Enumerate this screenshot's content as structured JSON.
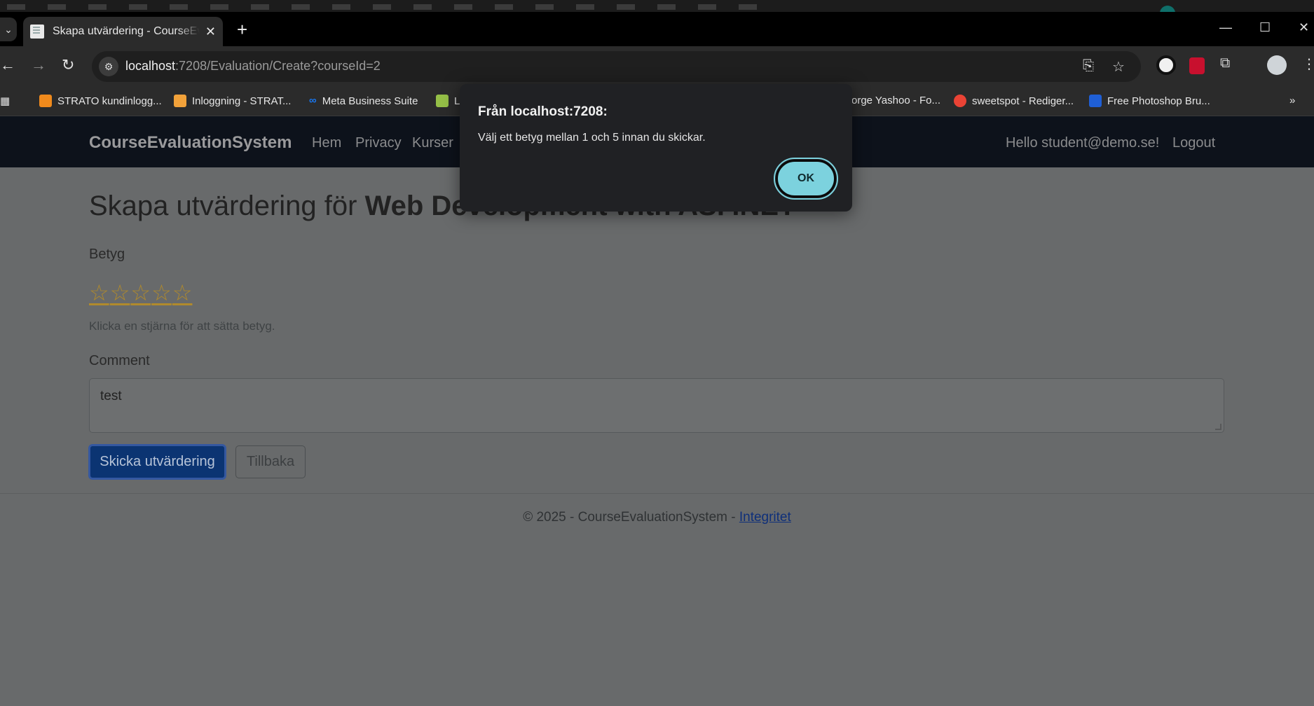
{
  "browser": {
    "tab_title": "Skapa utvärdering - CourseEvaluationSystem",
    "url_host": "localhost",
    "url_rest": ":7208/Evaluation/Create?courseId=2",
    "bookmarks": [
      {
        "label": "STRATO kundinlogg...",
        "color": "#f08a1c"
      },
      {
        "label": "Inloggning - STRAT...",
        "color": "#f2a23a"
      },
      {
        "label": "Meta Business Suite",
        "color": "#1877f2"
      },
      {
        "label": "Le",
        "color": "#95bf47"
      },
      {
        "label": "orge Yashoo - Fo...",
        "color": ""
      },
      {
        "label": "sweetspot - Rediger...",
        "color": "#ea4335"
      },
      {
        "label": "Free Photoshop Bru...",
        "color": "#1f5fd6"
      }
    ]
  },
  "nav": {
    "brand": "CourseEvaluationSystem",
    "links": [
      "Hem",
      "Privacy",
      "Kurser"
    ],
    "user": "Hello student@demo.se!",
    "logout": "Logout"
  },
  "form": {
    "heading_prefix": "Skapa utvärdering för ",
    "heading_course": "Web Development with ASP.NET",
    "rating_label": "Betyg",
    "stars": [
      "☆",
      "☆",
      "☆",
      "☆",
      "☆"
    ],
    "rating_value": 0,
    "rating_hint": "Klicka en stjärna för att sätta betyg.",
    "comment_label": "Comment",
    "comment_value": "test",
    "submit_label": "Skicka utvärdering",
    "back_label": "Tillbaka"
  },
  "footer": {
    "text": "© 2025 - CourseEvaluationSystem - ",
    "link": "Integritet"
  },
  "alert": {
    "title": "Från localhost:7208:",
    "message": "Välj ett betyg mellan 1 och 5 innan du skickar.",
    "ok_label": "OK"
  }
}
